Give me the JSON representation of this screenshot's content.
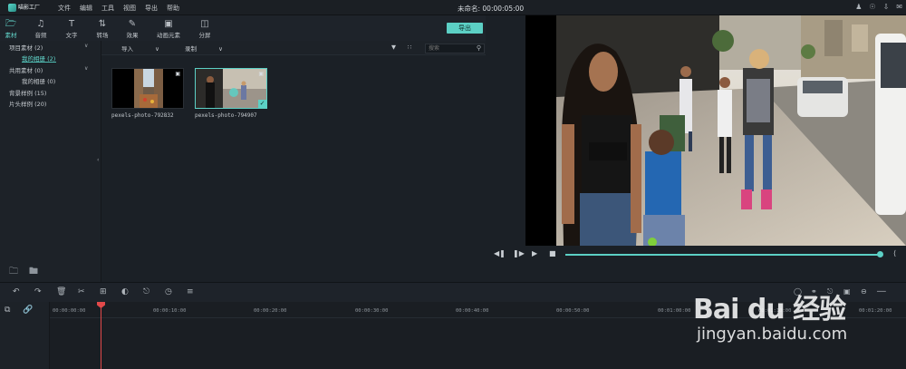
{
  "app": {
    "logo_text": "喵影工厂",
    "menu": [
      "文件",
      "编辑",
      "工具",
      "视图",
      "导出",
      "帮助"
    ],
    "document_title": "未命名: 00:00:05:00"
  },
  "toolbar": {
    "tools": [
      {
        "label": "素材",
        "icon": "folder-icon"
      },
      {
        "label": "音频",
        "icon": "music-note-icon"
      },
      {
        "label": "文字",
        "icon": "text-icon"
      },
      {
        "label": "转场",
        "icon": "transition-icon"
      },
      {
        "label": "效果",
        "icon": "effects-icon"
      },
      {
        "label": "动画元素",
        "icon": "image-icon"
      },
      {
        "label": "分屏",
        "icon": "split-screen-icon"
      }
    ],
    "export_label": "导出"
  },
  "sidebar": {
    "items": [
      {
        "label": "项目素材 (2)"
      },
      {
        "label": "我的相册 (2)"
      },
      {
        "label": "共用素材 (0)"
      },
      {
        "label": "我的相册 (0)"
      },
      {
        "label": "背景样例 (15)"
      },
      {
        "label": "片头样例 (20)"
      }
    ]
  },
  "media_header": {
    "import_label": "导入",
    "record_label": "录制",
    "search_placeholder": "搜索"
  },
  "media": {
    "items": [
      {
        "caption": "pexels-photo-792832"
      },
      {
        "caption": "pexels-photo-794907"
      }
    ]
  },
  "timeline": {
    "ruler_labels": [
      "00:00:00:00",
      "00:00:10:00",
      "00:00:20:00",
      "00:00:30:00",
      "00:00:40:00",
      "00:00:50:00",
      "00:01:00:00",
      "00:01:10:00",
      "00:01:20:00"
    ]
  },
  "watermark": {
    "line1": "Bai du 经验",
    "line2": "jingyan.baidu.com"
  },
  "colors": {
    "accent": "#5cd0c5",
    "playhead": "#e2494a",
    "background": "#1b2026"
  }
}
